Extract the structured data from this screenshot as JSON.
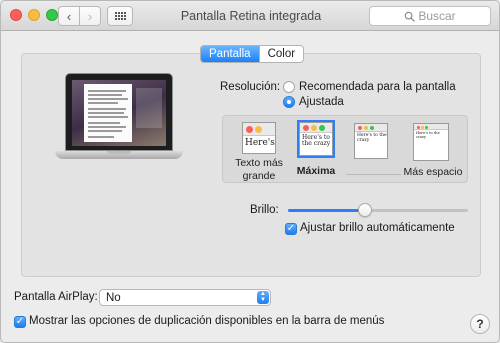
{
  "window": {
    "title": "Pantalla Retina integrada",
    "search_placeholder": "Buscar"
  },
  "tabs": [
    {
      "label": "Pantalla",
      "active": true
    },
    {
      "label": "Color",
      "active": false
    }
  ],
  "resolution": {
    "label": "Resolución:",
    "options": [
      {
        "label": "Recomendada para la pantalla",
        "selected": false
      },
      {
        "label": "Ajustada",
        "selected": true
      }
    ]
  },
  "scaling": {
    "sample_text": "Here's",
    "sample_text_small": "Here's to the crazy",
    "options": [
      {
        "label": "Texto más grande",
        "selected": false
      },
      {
        "label": "Máxima",
        "selected": true
      },
      {
        "label": "",
        "selected": false
      },
      {
        "label": "Más espacio",
        "selected": false
      }
    ]
  },
  "brightness": {
    "label": "Brillo:",
    "value_fraction": 0.43,
    "auto_label": "Ajustar brillo automáticamente",
    "auto_checked": true
  },
  "airplay": {
    "label": "Pantalla AirPlay:",
    "value": "No"
  },
  "mirroring": {
    "label": "Mostrar las opciones de duplicación disponibles en la barra de menús",
    "checked": true
  },
  "help_label": "?",
  "colors": {
    "accent": "#1a82fb",
    "close": "#fc605c",
    "minimize": "#fdbc40",
    "zoom": "#34c84a"
  }
}
